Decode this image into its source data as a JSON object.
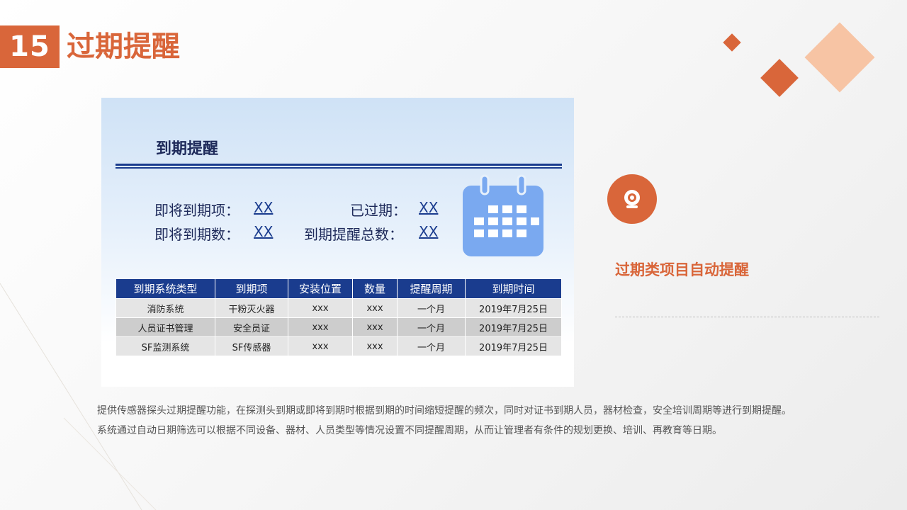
{
  "header": {
    "number": "15",
    "title": "过期提醒"
  },
  "panel": {
    "title": "到期提醒",
    "stats": {
      "upcoming_items_label": "即将到期项：",
      "upcoming_items_value": "XX",
      "upcoming_count_label": "即将到期数：",
      "upcoming_count_value": "XX",
      "expired_label": "已过期：",
      "expired_value": "XX",
      "total_reminders_label": "到期提醒总数：",
      "total_reminders_value": "XX"
    },
    "table": {
      "headers": [
        "到期系统类型",
        "到期项",
        "安装位置",
        "数量",
        "提醒周期",
        "到期时间"
      ],
      "rows": [
        [
          "消防系统",
          "干粉灭火器",
          "xxx",
          "xxx",
          "一个月",
          "2019年7月25日"
        ],
        [
          "人员证书管理",
          "安全员证",
          "xxx",
          "xxx",
          "一个月",
          "2019年7月25日"
        ],
        [
          "SF监测系统",
          "SF传感器",
          "xxx",
          "xxx",
          "一个月",
          "2019年7月25日"
        ]
      ]
    },
    "icons": {
      "calendar": "calendar-icon",
      "calendar_color": "#7aa9f0"
    }
  },
  "feature": {
    "title": "过期类项目自动提醒",
    "icon": "camera-icon"
  },
  "description": {
    "p1": "提供传感器探头过期提醒功能，在探测头到期或即将到期时根据到期的时间缩短提醒的频次，同时对证书到期人员，器材检查，安全培训周期等进行到期提醒。",
    "p2": "系统通过自动日期筛选可以根据不同设备、器材、人员类型等情况设置不同提醒周期，从而让管理者有条件的规划更换、培训、再教育等日期。"
  },
  "colors": {
    "accent": "#d9663a",
    "accent_light": "#f7c4a4",
    "navy": "#1a3c8e"
  }
}
